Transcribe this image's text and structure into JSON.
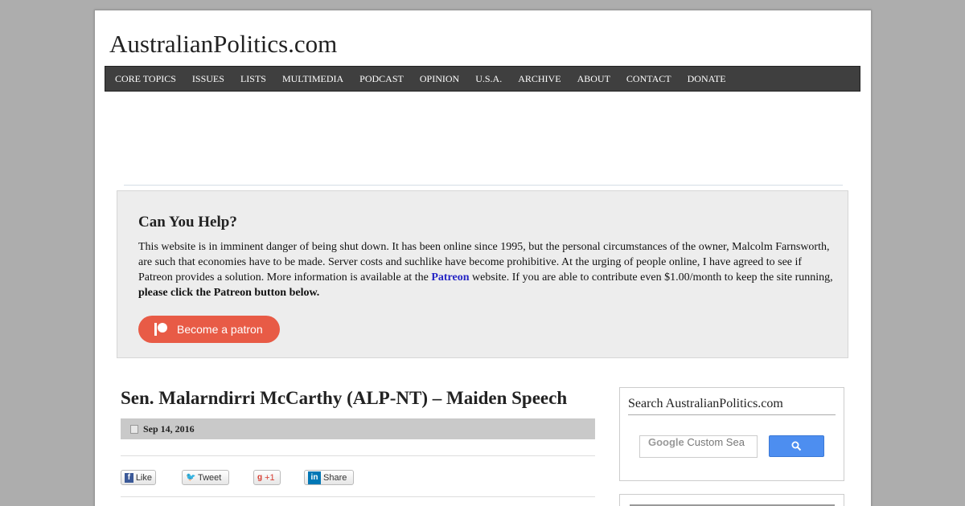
{
  "site": {
    "title": "AustralianPolitics.com"
  },
  "nav": {
    "items": [
      "CORE TOPICS",
      "ISSUES",
      "LISTS",
      "MULTIMEDIA",
      "PODCAST",
      "OPINION",
      "U.S.A.",
      "ARCHIVE",
      "ABOUT",
      "CONTACT",
      "DONATE"
    ]
  },
  "help": {
    "title": "Can You Help?",
    "text_before": "This website is in imminent danger of being shut down. It has been online since 1995, but the personal circumstances of the owner, Malcolm Farnsworth, are such that economies have to be made. Server costs and suchlike have become prohibitive. At the urging of people online, I have agreed to see if Patreon provides a solution. More information is available at the ",
    "link_text": "Patreon",
    "text_after": " website. If you are able to contribute even $1.00/month to keep the site running, ",
    "text_bold": "please click the Patreon button below.",
    "button_label": "Become a patron",
    "button_color": "#e85b46"
  },
  "post": {
    "title": "Sen. Malarndirri McCarthy (ALP-NT) – Maiden Speech",
    "date": "Sep 14, 2016"
  },
  "share": {
    "like": "Like",
    "tweet": "Tweet",
    "gplus": "+1",
    "linkedin": "Share"
  },
  "sidebar": {
    "search_title": "Search AustralianPolitics.com",
    "search_placeholder": "Custom Sea"
  },
  "colors": {
    "nav_bg": "#3f3f3f",
    "link": "#2525c4",
    "search_button": "#4d8ef0"
  }
}
